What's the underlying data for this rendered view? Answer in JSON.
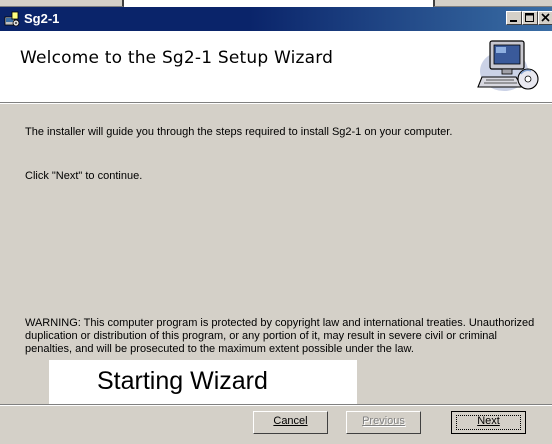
{
  "window": {
    "title": "Sg2-1",
    "icon": "setup-icon",
    "controls": [
      "minimize-icon",
      "maximize-icon",
      "close-icon"
    ]
  },
  "banner": {
    "heading": "Welcome to the Sg2-1 Setup Wizard",
    "icon": "computer-cd-icon"
  },
  "body": {
    "intro": "The installer will guide you through the steps required to install Sg2-1 on your computer.",
    "instruction": "Click \"Next\" to continue.",
    "warning": "WARNING: This computer program is protected by copyright law and international treaties. Unauthorized duplication or distribution of this program, or any portion of it, may result in severe civil or criminal penalties, and will be prosecuted to the maximum extent possible under the law."
  },
  "overlay": {
    "text": "Starting Wizard"
  },
  "buttons": {
    "cancel": "Cancel",
    "previous": "Previous",
    "next": "Next"
  },
  "colors": {
    "titlebar": "#0a246a",
    "face": "#d4d0c8",
    "disabled_text": "#808080"
  }
}
